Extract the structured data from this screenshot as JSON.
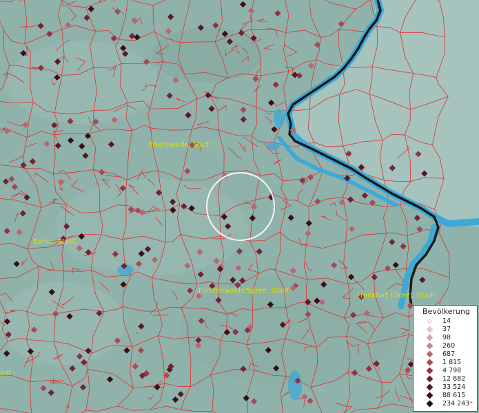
{
  "map": {
    "city_labels": [
      {
        "id": "eberswalde",
        "text": "Eberswalde, Stadt"
      },
      {
        "id": "berlin",
        "text": "Berlin, Stadt"
      },
      {
        "id": "fuerstenwalde",
        "text": "Fürstenwalde/Spree, Stadt"
      },
      {
        "id": "frankfurt",
        "text": "Frankfurt (Oder), Stadt"
      },
      {
        "id": "left-edge",
        "text": "adt"
      }
    ],
    "colors": {
      "land": "#8fb3ab",
      "boundaries": "#e03030",
      "river": "#3fa9d6",
      "border": "#1a1a1a",
      "label": "#e8e800"
    }
  },
  "legend": {
    "title": "Bevölkerung",
    "entries": [
      {
        "label": "14",
        "color": "#f5e1ea"
      },
      {
        "label": "37",
        "color": "#e8c3cf"
      },
      {
        "label": "98",
        "color": "#d9a2b2"
      },
      {
        "label": "260",
        "color": "#c98593"
      },
      {
        "label": "687",
        "color": "#b96673"
      },
      {
        "label": "1 815",
        "color": "#a44b59"
      },
      {
        "label": "4 798",
        "color": "#8e3444"
      },
      {
        "label": "12 682",
        "color": "#732333"
      },
      {
        "label": "33 524",
        "color": "#571826"
      },
      {
        "label": "88 615",
        "color": "#3a0e18"
      },
      {
        "label": "234 243⁺",
        "color": "#1a060b"
      }
    ]
  }
}
